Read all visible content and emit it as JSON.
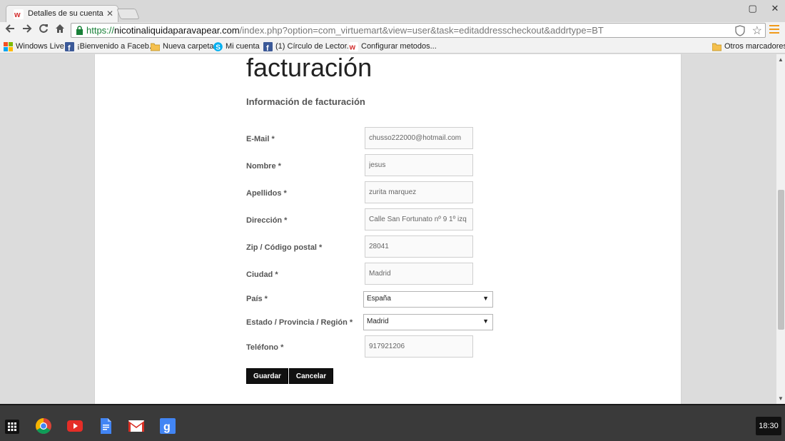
{
  "browser": {
    "tab_title": "Detalles de su cuenta",
    "tab_close": "✕",
    "window_controls": {
      "minimize": "▢",
      "close": "✕"
    },
    "url_scheme": "https://",
    "url_host": "nicotinaliquidaparavapear.com",
    "url_path": "/index.php?option=com_virtuemart&view=user&task=editaddresscheckout&addrtype=BT",
    "bookmarks": [
      {
        "label": "Windows Live",
        "icon": "windows-icon"
      },
      {
        "label": "¡Bienvenido a Faceb...",
        "icon": "facebook-icon"
      },
      {
        "label": "Nueva carpeta",
        "icon": "folder-icon"
      },
      {
        "label": "Mi cuenta",
        "icon": "skype-icon"
      },
      {
        "label": "(1) Círculo de Lector...",
        "icon": "facebook-icon"
      },
      {
        "label": "Configurar metodos...",
        "icon": "w-icon"
      }
    ],
    "other_bookmarks": "Otros marcadores"
  },
  "page": {
    "heading": "facturación",
    "section_title": "Información de facturación",
    "fields": [
      {
        "label": "E-Mail *",
        "value": "chusso222000@hotmail.com"
      },
      {
        "label": "Nombre *",
        "value": "jesus"
      },
      {
        "label": "Apellidos *",
        "value": "zurita marquez"
      },
      {
        "label": "Dirección *",
        "value": "Calle San Fortunato nº 9 1º izq"
      },
      {
        "label": "Zip / Código postal *",
        "value": "28041"
      },
      {
        "label": "Ciudad *",
        "value": "Madrid"
      }
    ],
    "country": {
      "label": "País *",
      "selected": "España"
    },
    "region": {
      "label": "Estado / Provincia / Región *",
      "selected": "Madrid"
    },
    "phone": {
      "label": "Teléfono *",
      "value": "917921206"
    },
    "save_button": "Guardar",
    "cancel_button": "Cancelar"
  },
  "taskbar": {
    "clock": "18:30",
    "apps": [
      "launcher-icon",
      "chrome-icon",
      "youtube-icon",
      "docs-icon",
      "gmail-icon",
      "google-search-icon"
    ]
  },
  "colors": {
    "accent_orange": "#f09a1a",
    "button_bg": "#111111",
    "url_green": "#188038"
  }
}
